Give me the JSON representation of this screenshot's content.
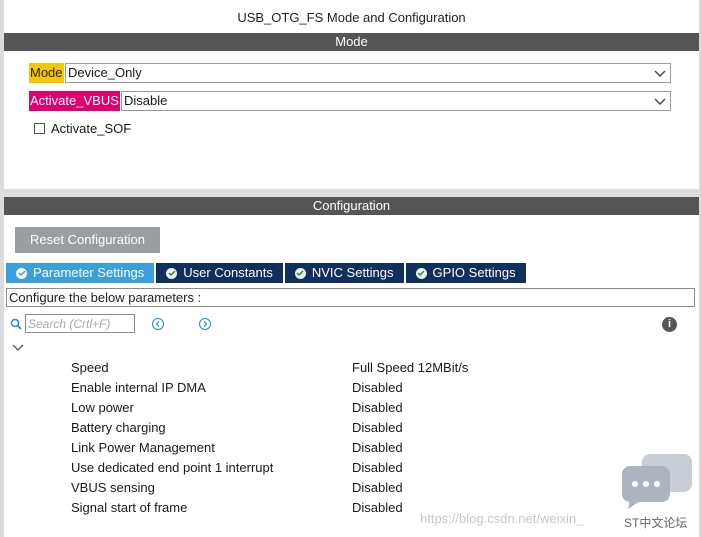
{
  "window": {
    "title": "USB_OTG_FS Mode and Configuration"
  },
  "mode_section": {
    "header": "Mode",
    "mode": {
      "label": "Mode",
      "value": "Device_Only"
    },
    "activate_vbus": {
      "label": "Activate_VBUS",
      "value": "Disable"
    },
    "activate_sof": {
      "label": "Activate_SOF",
      "checked": false
    }
  },
  "config_section": {
    "header": "Configuration",
    "reset_button": "Reset Configuration",
    "tabs": [
      {
        "label": "Parameter Settings",
        "active": true
      },
      {
        "label": "User Constants",
        "active": false
      },
      {
        "label": "NVIC Settings",
        "active": false
      },
      {
        "label": "GPIO Settings",
        "active": false
      }
    ],
    "hint": "Configure the below parameters :",
    "search": {
      "placeholder": "Search (Crtl+F)"
    },
    "parameters": [
      {
        "name": "Speed",
        "value": "Full Speed 12MBit/s"
      },
      {
        "name": "Enable internal IP DMA",
        "value": "Disabled"
      },
      {
        "name": "Low power",
        "value": "Disabled"
      },
      {
        "name": "Battery charging",
        "value": "Disabled"
      },
      {
        "name": "Link Power Management",
        "value": "Disabled"
      },
      {
        "name": "Use dedicated end point 1 interrupt",
        "value": "Disabled"
      },
      {
        "name": "VBUS sensing",
        "value": "Disabled"
      },
      {
        "name": "Signal start of frame",
        "value": "Disabled"
      }
    ]
  },
  "watermark": {
    "url": "https://blog.csdn.net/weixin_",
    "brand": "ST中文论坛"
  },
  "colors": {
    "section_bar": "#555555",
    "mode_label": "#f7c600",
    "vbus_label": "#e0006f",
    "tab_active": "#3aa0dc",
    "tab_inactive": "#0f2f5f",
    "button": "#9a9ea3"
  }
}
